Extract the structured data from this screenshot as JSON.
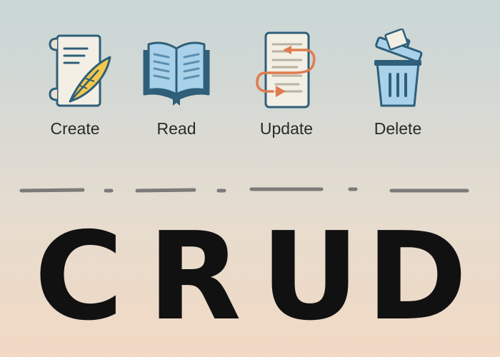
{
  "operations": [
    {
      "label": "Create",
      "icon": "scroll-quill-icon"
    },
    {
      "label": "Read",
      "icon": "open-book-icon"
    },
    {
      "label": "Update",
      "icon": "document-arrows-icon"
    },
    {
      "label": "Delete",
      "icon": "trash-can-icon"
    }
  ],
  "acronym": {
    "letters": [
      "C",
      "R",
      "U",
      "D"
    ]
  },
  "colors": {
    "icon_outline": "#2f5f7a",
    "paper": "#f3efe4",
    "book_blue": "#a9d2ea",
    "quill": "#f2c84b",
    "arrow": "#e07b4f",
    "text": "#111111"
  }
}
